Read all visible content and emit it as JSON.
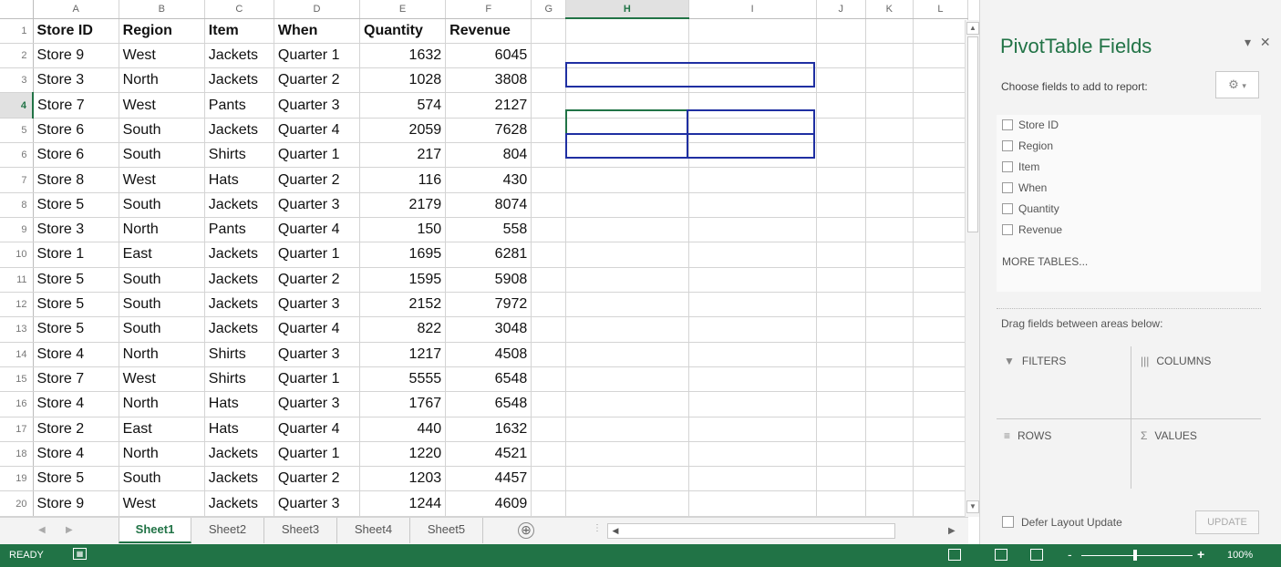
{
  "sheet": {
    "columns": [
      "A",
      "B",
      "C",
      "D",
      "E",
      "F",
      "G",
      "H",
      "I",
      "J",
      "K",
      "L"
    ],
    "rows": [
      {
        "num": "1",
        "cells": [
          "Store ID",
          "Region",
          "Item",
          "When",
          "Quantity",
          "Revenue"
        ]
      },
      {
        "num": "2",
        "cells": [
          "Store 9",
          "West",
          "Jackets",
          "Quarter 1",
          "1632",
          "6045"
        ]
      },
      {
        "num": "3",
        "cells": [
          "Store 3",
          "North",
          "Jackets",
          "Quarter 2",
          "1028",
          "3808"
        ]
      },
      {
        "num": "4",
        "cells": [
          "Store 7",
          "West",
          "Pants",
          "Quarter 3",
          "574",
          "2127"
        ]
      },
      {
        "num": "5",
        "cells": [
          "Store 6",
          "South",
          "Jackets",
          "Quarter 4",
          "2059",
          "7628"
        ]
      },
      {
        "num": "6",
        "cells": [
          "Store 6",
          "South",
          "Shirts",
          "Quarter 1",
          "217",
          "804"
        ]
      },
      {
        "num": "7",
        "cells": [
          "Store 8",
          "West",
          "Hats",
          "Quarter 2",
          "116",
          "430"
        ]
      },
      {
        "num": "8",
        "cells": [
          "Store 5",
          "South",
          "Jackets",
          "Quarter 3",
          "2179",
          "8074"
        ]
      },
      {
        "num": "9",
        "cells": [
          "Store 3",
          "North",
          "Pants",
          "Quarter 4",
          "150",
          "558"
        ]
      },
      {
        "num": "10",
        "cells": [
          "Store 1",
          "East",
          "Jackets",
          "Quarter 1",
          "1695",
          "6281"
        ]
      },
      {
        "num": "11",
        "cells": [
          "Store 5",
          "South",
          "Jackets",
          "Quarter 2",
          "1595",
          "5908"
        ]
      },
      {
        "num": "12",
        "cells": [
          "Store 5",
          "South",
          "Jackets",
          "Quarter 3",
          "2152",
          "7972"
        ]
      },
      {
        "num": "13",
        "cells": [
          "Store 5",
          "South",
          "Jackets",
          "Quarter 4",
          "822",
          "3048"
        ]
      },
      {
        "num": "14",
        "cells": [
          "Store 4",
          "North",
          "Shirts",
          "Quarter 3",
          "1217",
          "4508"
        ]
      },
      {
        "num": "15",
        "cells": [
          "Store 7",
          "West",
          "Shirts",
          "Quarter 1",
          "5555",
          "6548"
        ]
      },
      {
        "num": "16",
        "cells": [
          "Store 4",
          "North",
          "Hats",
          "Quarter 3",
          "1767",
          "6548"
        ]
      },
      {
        "num": "17",
        "cells": [
          "Store 2",
          "East",
          "Hats",
          "Quarter 4",
          "440",
          "1632"
        ]
      },
      {
        "num": "18",
        "cells": [
          "Store 4",
          "North",
          "Jackets",
          "Quarter 1",
          "1220",
          "4521"
        ]
      },
      {
        "num": "19",
        "cells": [
          "Store 5",
          "South",
          "Jackets",
          "Quarter 2",
          "1203",
          "4457"
        ]
      },
      {
        "num": "20",
        "cells": [
          "Store 9",
          "West",
          "Jackets",
          "Quarter 3",
          "1244",
          "4609"
        ]
      }
    ],
    "selected_column": "H",
    "selected_row": "4",
    "tabs": [
      "Sheet1",
      "Sheet2",
      "Sheet3",
      "Sheet4",
      "Sheet5"
    ],
    "active_tab": "Sheet1",
    "add_sheet_icon": "⊕"
  },
  "pivot": {
    "title": "PivotTable Fields",
    "choose_label": "Choose fields to add to report:",
    "fields": [
      "Store ID",
      "Region",
      "Item",
      "When",
      "Quantity",
      "Revenue"
    ],
    "more_tables": "MORE TABLES...",
    "drag_label": "Drag fields between areas below:",
    "areas": {
      "filters": "FILTERS",
      "columns": "COLUMNS",
      "rows": "ROWS",
      "values": "VALUES"
    },
    "defer_label": "Defer Layout Update",
    "update_label": "UPDATE"
  },
  "status": {
    "ready": "READY",
    "zoom_minus": "-",
    "zoom_plus": "+",
    "zoom": "100%"
  },
  "colors": {
    "accent": "#217346",
    "selection": "#1f2fa2"
  }
}
